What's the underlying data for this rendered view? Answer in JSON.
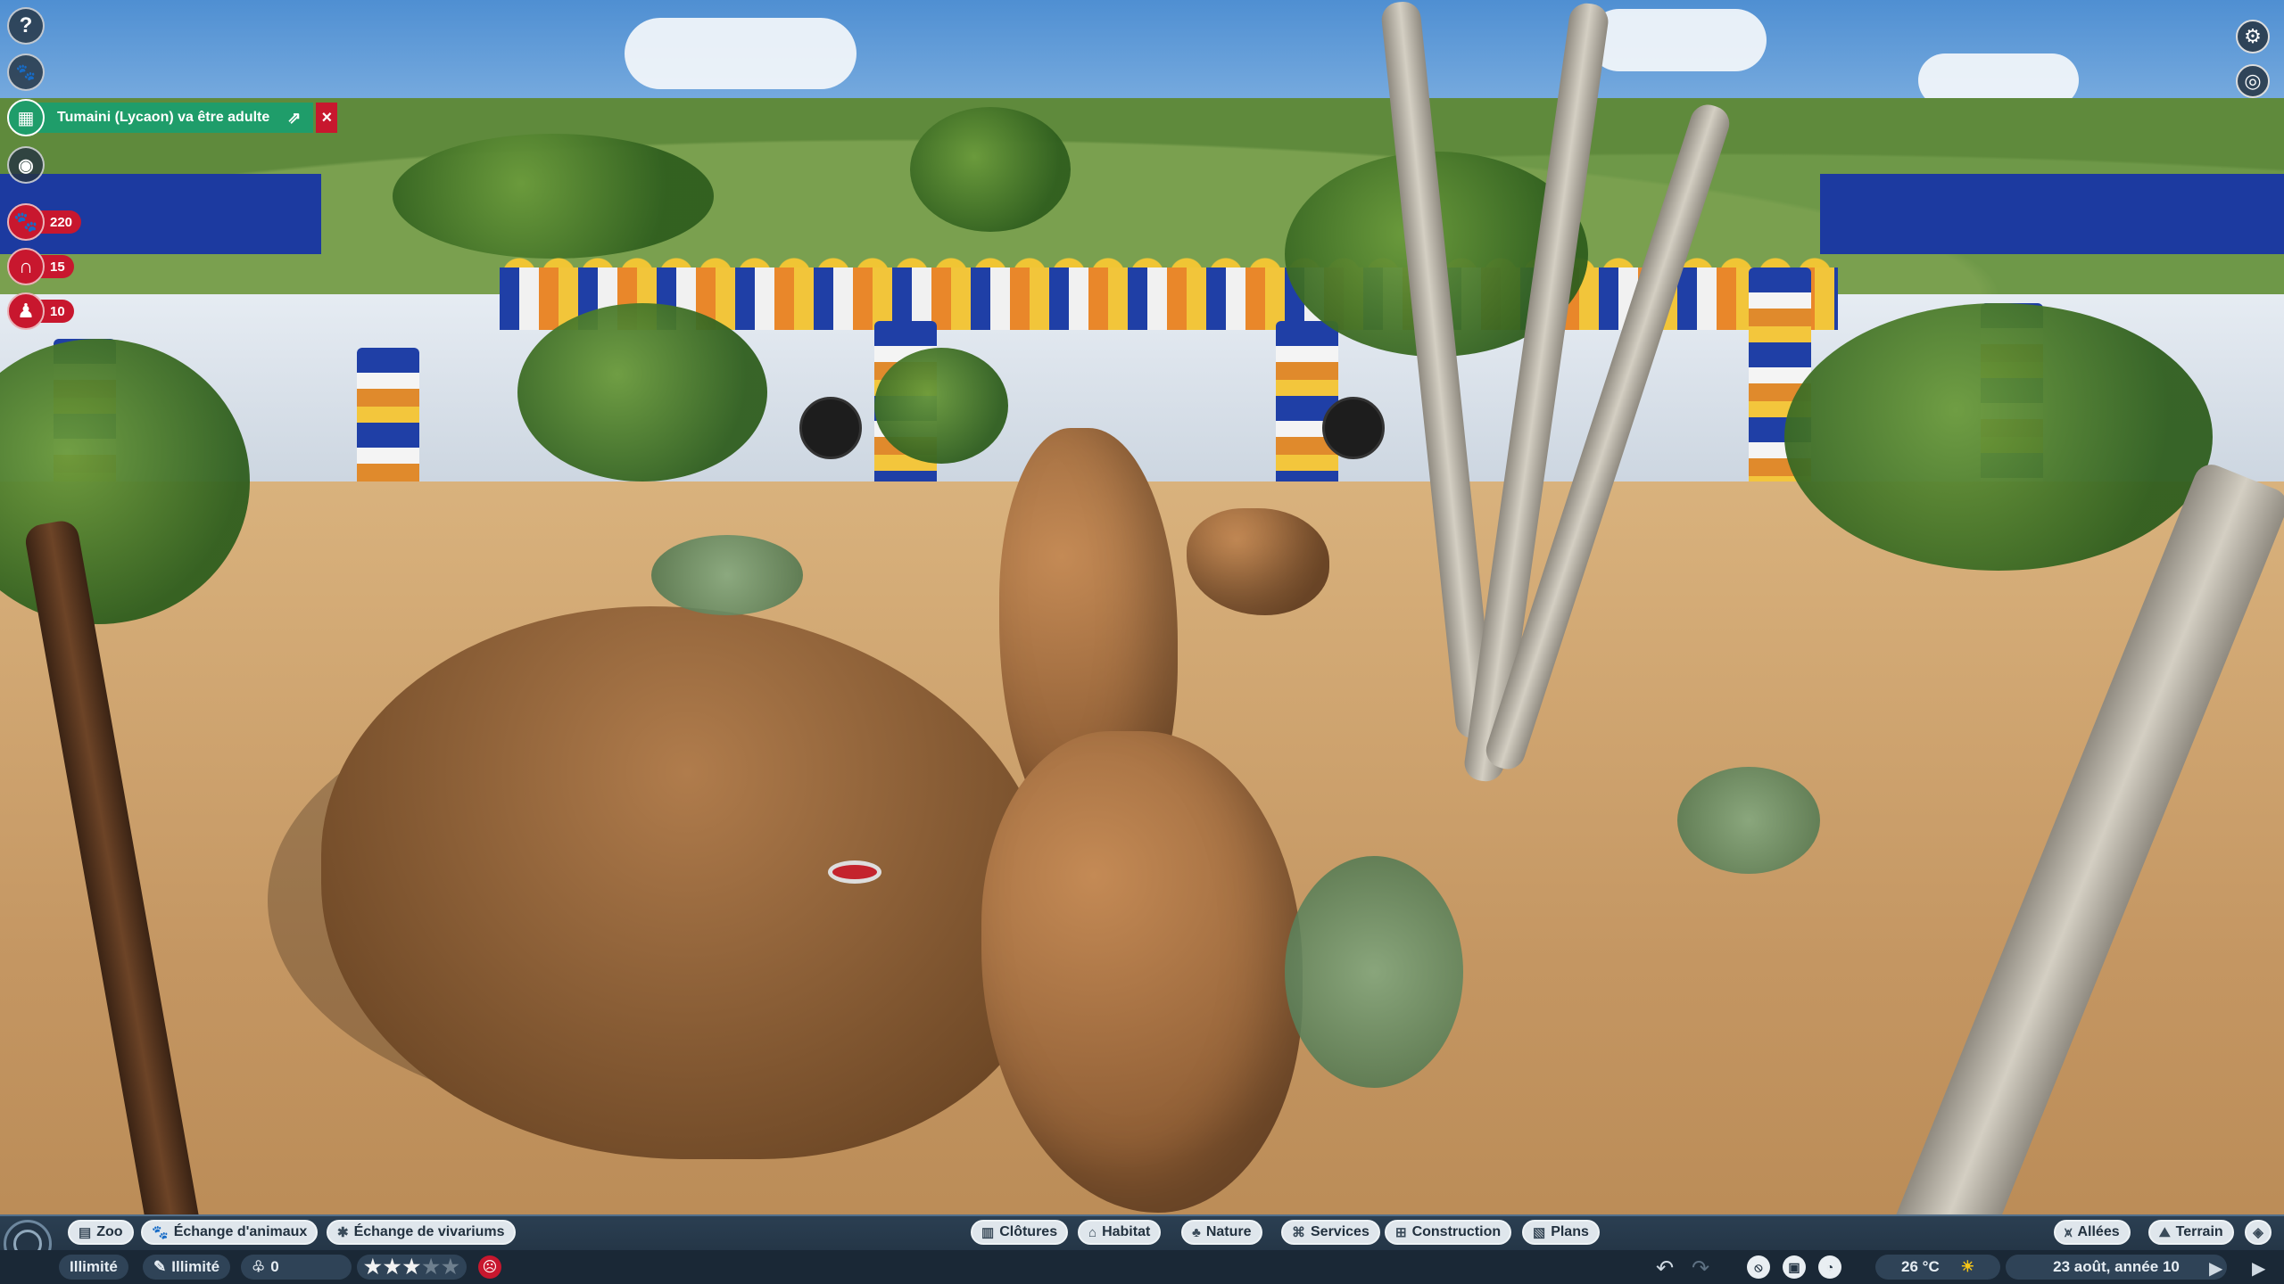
{
  "notification": {
    "text": "Tumaini (Lycaon) va être adulte",
    "icon": "calendar-icon",
    "open_icon": "external-link-icon",
    "close_icon": "close-icon",
    "color": "#1f9d6a"
  },
  "left_hud": {
    "buttons": [
      "help-icon",
      "animal-info-icon",
      "calendar-icon",
      "vision-icon"
    ],
    "counters": [
      {
        "icon": "paw-icon",
        "value": "220"
      },
      {
        "icon": "magnet-icon",
        "value": "15"
      },
      {
        "icon": "guest-icon",
        "value": "10"
      }
    ]
  },
  "top_right": {
    "buttons": [
      "settings-gear-icon",
      "view-eye-icon"
    ]
  },
  "toolbar": {
    "left": [
      {
        "label": "Zoo",
        "icon": "zoo-icon"
      },
      {
        "label": "Échange d'animaux",
        "icon": "paw-icon"
      },
      {
        "label": "Échange de vivariums",
        "icon": "bug-icon"
      }
    ],
    "center": [
      {
        "label": "Clôtures",
        "icon": "fence-icon"
      },
      {
        "label": "Habitat",
        "icon": "habitat-icon"
      },
      {
        "label": "Nature",
        "icon": "tree-icon"
      },
      {
        "label": "Services",
        "icon": "shop-icon"
      },
      {
        "label": "Construction",
        "icon": "building-icon"
      },
      {
        "label": "Plans",
        "icon": "blueprint-icon"
      }
    ],
    "right": [
      {
        "label": "Allées",
        "icon": "path-icon"
      },
      {
        "label": "Terrain",
        "icon": "terrain-icon"
      }
    ]
  },
  "status": {
    "money": "Illimité",
    "research": "Illimité",
    "conservation": "0",
    "rating_stars": 3,
    "rating_max": 5,
    "temperature": "26 °C",
    "weather_icon": "sun-icon",
    "date": "23 août, année 10"
  }
}
